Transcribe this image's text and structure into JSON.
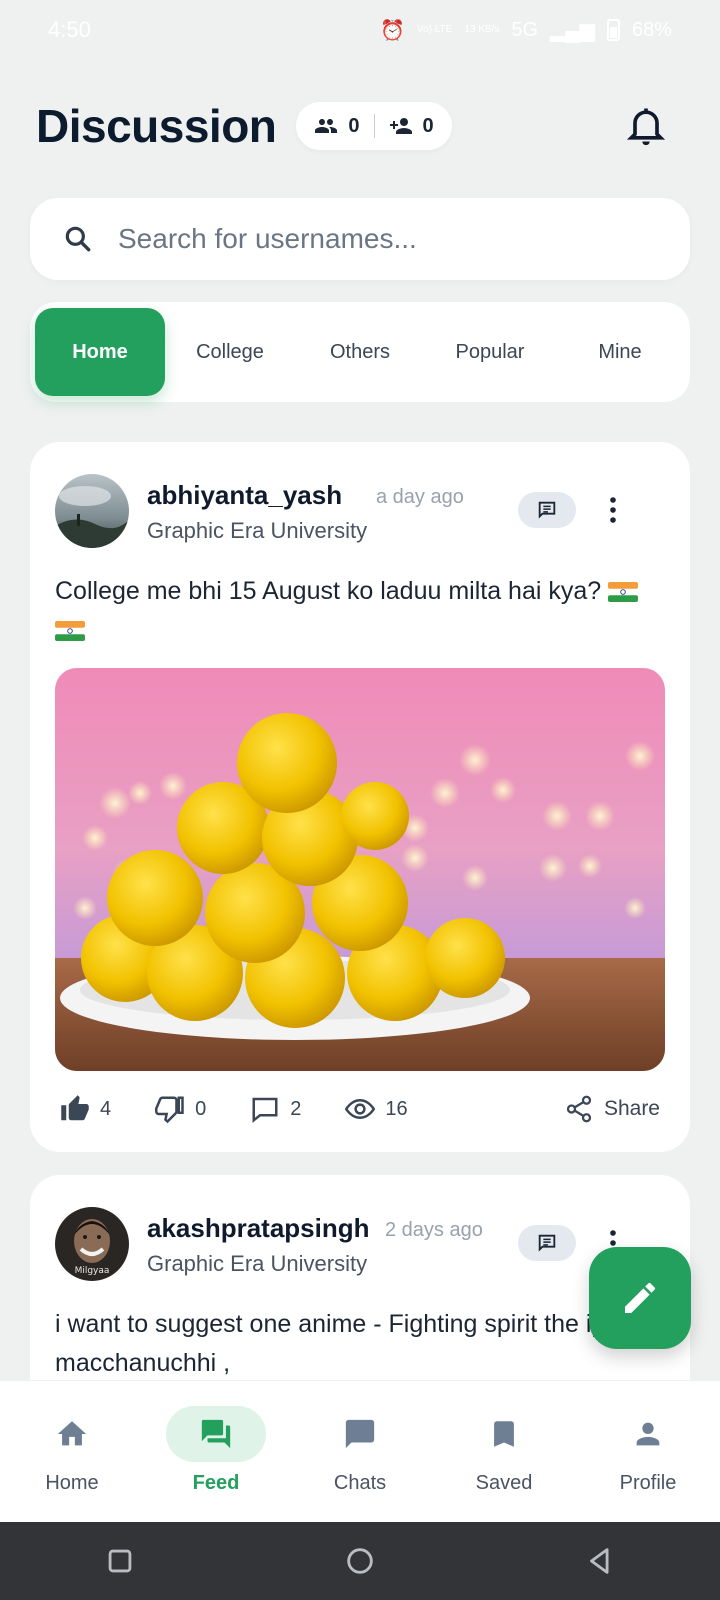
{
  "status_bar": {
    "time": "4:50",
    "network_speed": "13 KB/s",
    "network": "5G",
    "volte": "Vo) LTE",
    "battery": "68%"
  },
  "header": {
    "title": "Discussion",
    "followers_count": "0",
    "following_count": "0"
  },
  "search": {
    "placeholder": "Search for usernames..."
  },
  "tabs": [
    {
      "label": "Home",
      "active": true
    },
    {
      "label": "College",
      "active": false
    },
    {
      "label": "Others",
      "active": false
    },
    {
      "label": "Popular",
      "active": false
    },
    {
      "label": "Mine",
      "active": false
    }
  ],
  "posts": [
    {
      "username": "abhiyanta_yash",
      "time_ago": "a day ago",
      "college": "Graphic Era University",
      "text": "College me bhi 15 August ko laduu milta hai kya?",
      "likes": "4",
      "dislikes": "0",
      "comments": "2",
      "views": "16",
      "share_label": "Share"
    },
    {
      "username": "akashpratapsingh",
      "time_ago": "2 days ago",
      "college": "Graphic Era University",
      "text": "i want to suggest one anime - Fighting spirit the ippo macchanuchhi ,",
      "avatar_caption": "Milgyaa"
    }
  ],
  "bottom_nav": [
    {
      "label": "Home",
      "icon": "home-icon"
    },
    {
      "label": "Feed",
      "icon": "forum-icon",
      "active": true
    },
    {
      "label": "Chats",
      "icon": "chat-icon"
    },
    {
      "label": "Saved",
      "icon": "bookmark-icon"
    },
    {
      "label": "Profile",
      "icon": "person-icon"
    }
  ],
  "colors": {
    "accent": "#23a05e",
    "accent_light": "#dff3e8",
    "background": "#eff1f1",
    "text": "#0f1b2d"
  }
}
